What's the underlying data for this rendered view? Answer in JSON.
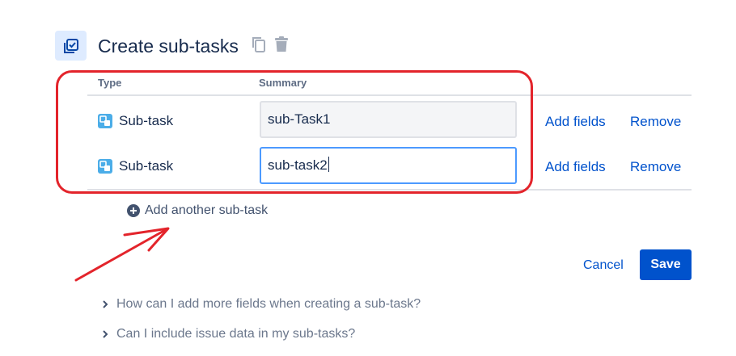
{
  "header": {
    "title": "Create sub-tasks",
    "icons": [
      "checkbox-icon",
      "copy-icon",
      "trash-icon"
    ]
  },
  "table": {
    "columns": {
      "type": "Type",
      "summary": "Summary"
    },
    "rows": [
      {
        "type": "Sub-task",
        "summary": "sub-Task1",
        "add_fields": "Add fields",
        "remove": "Remove",
        "focused": false
      },
      {
        "type": "Sub-task",
        "summary": "sub-task2",
        "add_fields": "Add fields",
        "remove": "Remove",
        "focused": true
      }
    ]
  },
  "add_another": {
    "label": "Add another sub-task",
    "icon": "plus-circle-icon"
  },
  "actions": {
    "cancel": "Cancel",
    "save": "Save"
  },
  "faq": [
    "How can I add more fields when creating a sub-task?",
    "Can I include issue data in my sub-tasks?"
  ],
  "annotation": {
    "highlight_color": "#e3242b"
  },
  "colors": {
    "primary": "#0052cc",
    "text": "#172b4d",
    "muted": "#6b778c",
    "focus": "#4c9aff",
    "subtask": "#4bade8"
  }
}
